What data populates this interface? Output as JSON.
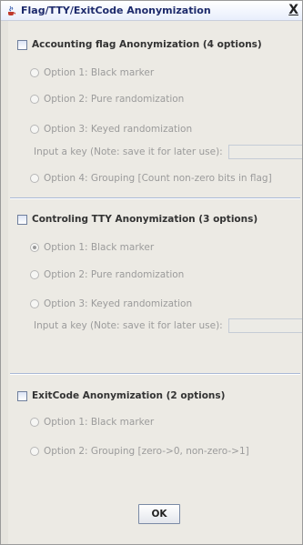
{
  "window": {
    "title": "Flag/TTY/ExitCode Anonymization",
    "close_label": "X"
  },
  "sections": [
    {
      "title": "Accounting flag Anonymization (4 options)",
      "options": [
        "Option 1: Black marker",
        "Option 2: Pure randomization",
        "Option 3: Keyed randomization",
        "Option 4: Grouping [Count non-zero bits in flag]"
      ],
      "key_label": "Input a key (Note: save it for later use):",
      "key_value": "",
      "selected_option": null
    },
    {
      "title": "Controling TTY Anonymization (3 options)",
      "options": [
        "Option 1: Black marker",
        "Option 2: Pure randomization",
        "Option 3: Keyed randomization"
      ],
      "key_label": "Input a key (Note: save it for later use):",
      "key_value": "",
      "selected_option": 0
    },
    {
      "title": "ExitCode Anonymization (2 options)",
      "options": [
        "Option 1: Black marker",
        "Option 2: Grouping [zero->0, non-zero->1]"
      ],
      "selected_option": null
    }
  ],
  "buttons": {
    "ok_label": "OK"
  },
  "colors": {
    "title_text": "#1d2a6b",
    "disabled_text": "#9b9b9b",
    "separator": "#a9b8d6"
  }
}
